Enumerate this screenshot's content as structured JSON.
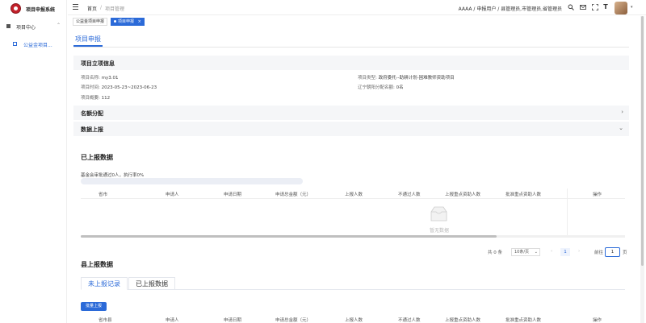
{
  "app": {
    "title": "项目申报系统"
  },
  "sidebar": {
    "group": {
      "label": "项目中心"
    },
    "items": [
      {
        "label": "公益金项目..."
      }
    ]
  },
  "topbar": {
    "breadcrumb": {
      "home": "首页",
      "separator": "/",
      "current": "项目管理"
    },
    "user_roles": "AAAA / 申报用户 / 县管理员,市管理员,省管理员",
    "icons": [
      "search-icon",
      "mail-icon",
      "fullscreen-icon",
      "font-size-icon"
    ]
  },
  "tags": [
    {
      "label": "公益金项目申报",
      "active": false
    },
    {
      "label": "项目申报",
      "active": true,
      "close": "×"
    }
  ],
  "page": {
    "tab": "项目申报"
  },
  "project_info": {
    "section_title": "项目立项信息",
    "name_label": "项目名称:",
    "name_value": "my3.01",
    "type_label": "项目类型:",
    "type_value": "政府委托--助耕计划-困难教师资助项目",
    "time_label": "项目时间:",
    "time_value": "2023-05-23~2023-06-23",
    "quota_label": "辽宁朝阳分配名额:",
    "quota_value": "0名",
    "summary_label": "项目概要:",
    "summary_value": "112"
  },
  "sections": {
    "quota": {
      "title": "名额分配",
      "arrow": "›"
    },
    "report": {
      "title": "数据上报",
      "arrow": "⌄"
    }
  },
  "reported": {
    "title": "已上报数据",
    "rate_text": "基金会审批通过0人，执行率0%",
    "progress": 0,
    "columns": [
      "省市",
      "申请人",
      "申请日期",
      "申请总金额（元）",
      "上报人数",
      "不通过人数",
      "上报重点资助人数",
      "批准重点资助人数",
      "操作"
    ],
    "empty_text": "暂无数据"
  },
  "pagination": {
    "total": "共 0 条",
    "page_size": "10条/页",
    "prev": "‹",
    "current": "1",
    "next": "›",
    "goto_label": "前往",
    "goto_value": "1",
    "page_unit": "页"
  },
  "county": {
    "title": "县上报数据",
    "tabs": [
      "未上报记录",
      "已上报数据"
    ],
    "batch_button": "批量上报",
    "columns": [
      "省市县",
      "申请人",
      "申请日期",
      "申请总金额（元）",
      "上报人数",
      "不通过人数",
      "上报重点资助人数",
      "批准重点资助人数",
      "操作"
    ]
  }
}
